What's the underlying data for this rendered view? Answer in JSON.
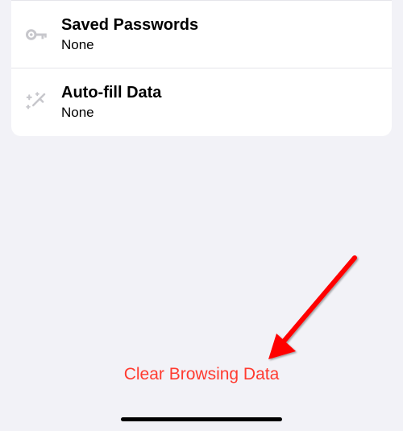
{
  "rows": [
    {
      "title": "Saved Passwords",
      "subtitle": "None"
    },
    {
      "title": "Auto-fill Data",
      "subtitle": "None"
    }
  ],
  "clear_button_label": "Clear Browsing Data",
  "colors": {
    "destructive": "#ff3b30",
    "icon_inactive": "#c7c7cc",
    "background": "#f2f2f7"
  },
  "annotation": {
    "type": "arrow",
    "color": "#ff0000"
  }
}
